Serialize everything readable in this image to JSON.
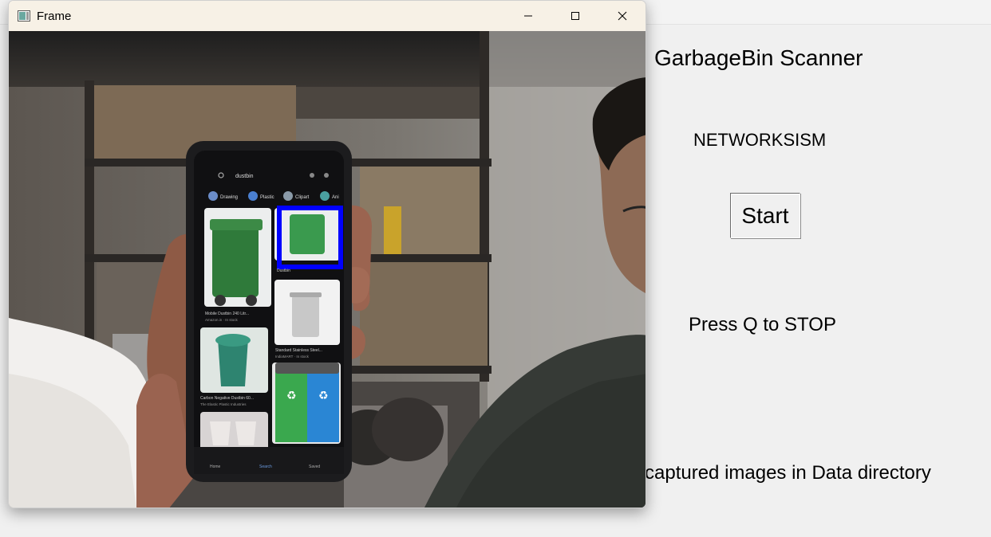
{
  "background_app": {
    "title": "GarbageBin Scanner",
    "brand": "NETWORKSISM",
    "start_button": "Start",
    "stop_hint": "Press Q to STOP",
    "info": "captured images in Data directory"
  },
  "frame_window": {
    "title": "Frame",
    "controls": [
      "minimize-icon",
      "maximize-icon",
      "close-icon"
    ]
  },
  "phone_screen": {
    "search_query": "dustbin",
    "filter_chips": [
      "Drawing",
      "Plastic",
      "Clipart",
      "Ani"
    ],
    "results": [
      {
        "caption": "Mobile Dustbin 240 Litr...",
        "source": "Amazon.in · In stock"
      },
      {
        "caption": "Dustbin",
        "source": ""
      },
      {
        "caption": "Standard Stainless Steel...",
        "source": "IndiaMART · In stock"
      },
      {
        "caption": "Carbon Negative Dustbin 60...",
        "source": "The Elastic Plastic Industries"
      }
    ],
    "nav": [
      "Home",
      "Search",
      "Saved"
    ]
  },
  "colors": {
    "detection_box": "#0000ff",
    "bin_green": "#2e8b3e",
    "bin_blue": "#1f7fc4",
    "titlebar": "#f7f1e6"
  }
}
